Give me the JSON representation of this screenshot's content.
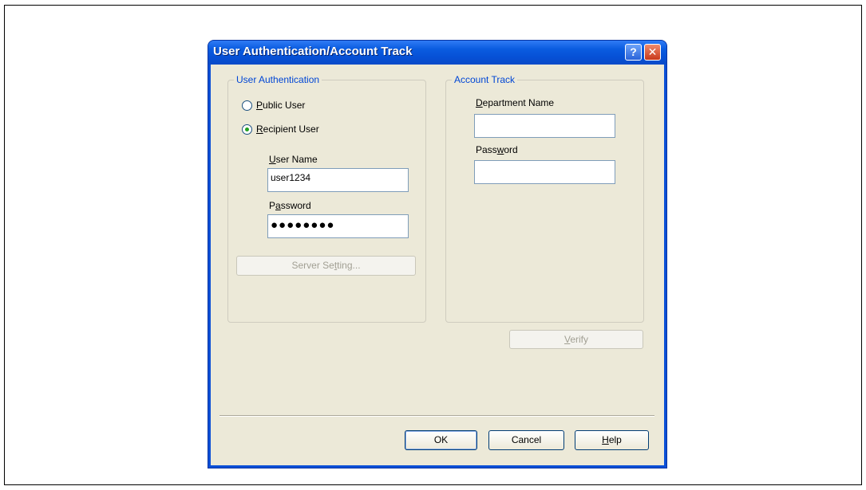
{
  "dialog": {
    "title": "User Authentication/Account Track",
    "help_glyph": "?",
    "close_glyph": "✕"
  },
  "user_auth": {
    "legend": "User Authentication",
    "public_user": {
      "pre": "",
      "key": "P",
      "post": "ublic User",
      "selected": false
    },
    "recipient_user": {
      "pre": "",
      "key": "R",
      "post": "ecipient User",
      "selected": true
    },
    "user_name_label": {
      "pre": "",
      "key": "U",
      "post": "ser Name"
    },
    "user_name_value": "user1234",
    "password_label": {
      "pre": "P",
      "key": "a",
      "post": "ssword"
    },
    "password_value": "●●●●●●●●",
    "server_setting": {
      "pre": "Server Se",
      "key": "t",
      "post": "ting..."
    }
  },
  "account_track": {
    "legend": "Account Track",
    "department_label": {
      "pre": "",
      "key": "D",
      "post": "epartment Name"
    },
    "department_value": "",
    "password_label": {
      "pre": "Pass",
      "key": "w",
      "post": "ord"
    },
    "password_value": ""
  },
  "buttons": {
    "verify": {
      "pre": "",
      "key": "V",
      "post": "erify"
    },
    "ok": "OK",
    "cancel": "Cancel",
    "help": {
      "pre": "",
      "key": "H",
      "post": "elp"
    }
  }
}
